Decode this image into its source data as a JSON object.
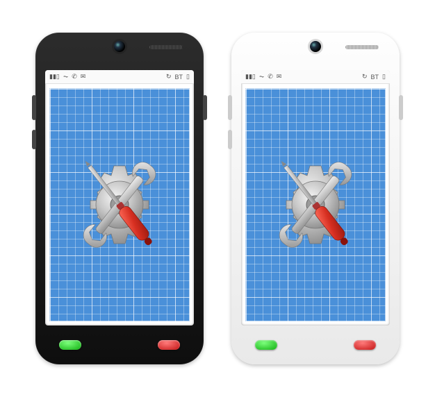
{
  "phones": [
    {
      "variant": "black"
    },
    {
      "variant": "white"
    }
  ],
  "status": {
    "signal_icon": "signal",
    "wifi_icon": "wifi",
    "call_icon": "phone",
    "chat_icon": "chat",
    "sync_icon": "↻",
    "bt_icon": "BT",
    "battery_icon": "battery"
  },
  "buttons": {
    "call": "call",
    "end": "end"
  },
  "graphic": {
    "gear": "gear-icon",
    "wrench": "wrench-icon",
    "screwdriver": "screwdriver-icon"
  }
}
